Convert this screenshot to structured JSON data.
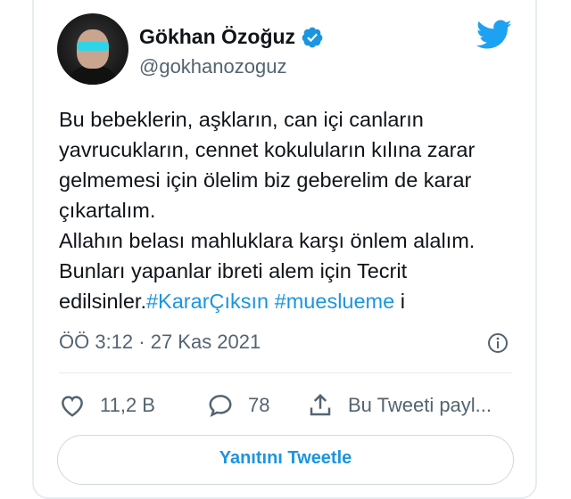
{
  "tweet": {
    "author": {
      "display_name": "Gökhan Özoğuz",
      "handle": "@gokhanozoguz",
      "verified": true
    },
    "text_lines": [
      "Bu bebeklerin, aşkların, can içi canların",
      "yavrucukların, cennet kokuluların kılına zarar",
      "gelmemesi için ölelim biz geberelim de karar",
      "çıkartalım.",
      "Allahın belası mahluklara karşı önlem alalım.",
      "Bunları yapanlar ibreti alem için Tecrit"
    ],
    "last_line_prefix": "edilsinler.",
    "hashtags": [
      "#KararÇıksın",
      "#mueslueme"
    ],
    "last_line_suffix": " i",
    "timestamp": "ÖÖ 3:12 · 27 Kas 2021"
  },
  "actions": {
    "like_count": "11,2 B",
    "comment_count": "78",
    "share_label": "Bu Tweeti payl..."
  },
  "reply_button_label": "Yanıtını Tweetle",
  "icons": {
    "brand": "twitter-bird-icon",
    "verified": "verified-badge-icon",
    "info": "info-icon",
    "like": "heart-icon",
    "comment": "comment-icon",
    "share": "share-icon"
  },
  "colors": {
    "accent": "#1b95e0",
    "secondary_text": "#536471",
    "border": "#e6ecf0"
  }
}
